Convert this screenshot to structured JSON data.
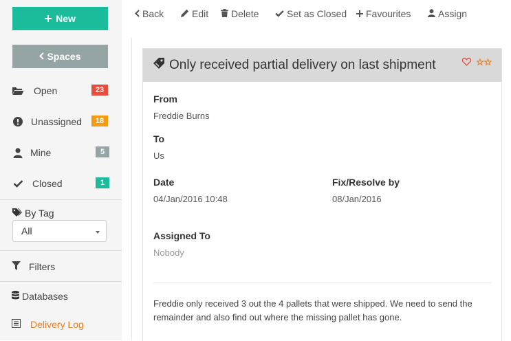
{
  "sidebar": {
    "new_label": "New",
    "spaces_label": "Spaces",
    "nav": [
      {
        "label": "Open",
        "count": "23",
        "badge_color": "#e74c3c",
        "icon": "folder-open-icon"
      },
      {
        "label": "Unassigned",
        "count": "18",
        "badge_color": "#f39c12",
        "icon": "exclamation-circle-icon"
      },
      {
        "label": "Mine",
        "count": "5",
        "badge_color": "#95a5a6",
        "icon": "user-icon"
      },
      {
        "label": "Closed",
        "count": "1",
        "badge_color": "#1abc9c",
        "icon": "check-icon"
      }
    ],
    "by_tag_label": "By Tag",
    "tag_select_value": "All",
    "filters_label": "Filters",
    "databases_label": "Databases",
    "delivery_log_label": "Delivery Log"
  },
  "toolbar": {
    "back": "Back",
    "edit": "Edit",
    "delete": "Delete",
    "set_closed": "Set as Closed",
    "favourites": "Favourites",
    "assign": "Assign"
  },
  "ticket": {
    "title": "Only received partial delivery on last shipment",
    "from_label": "From",
    "from_value": "Freddie Burns",
    "to_label": "To",
    "to_value": "Us",
    "date_label": "Date",
    "date_value": "04/Jan/2016 10:48",
    "resolve_label": "Fix/Resolve by",
    "resolve_value": "08/Jan/2016",
    "assigned_label": "Assigned To",
    "assigned_value": "Nobody",
    "description": "Freddie only received 3 out the 4 pallets that were shipped. We need to send the remainder and also find out where the missing pallet has gone."
  },
  "colors": {
    "accent_green": "#1abc9c",
    "orange": "#e67e22",
    "heart_red": "#e74c3c"
  }
}
